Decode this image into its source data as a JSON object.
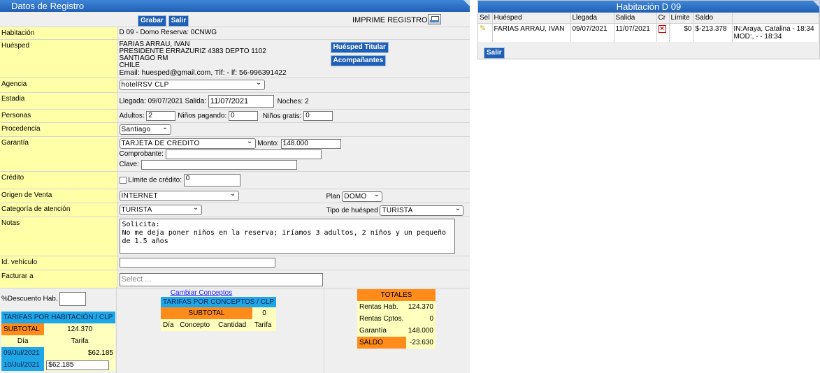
{
  "registro": {
    "title": "Datos de Registro",
    "grabar_label": "Grabar",
    "salir_label": "Salir",
    "imprime_label": "IMPRIME REGISTRO:",
    "fields": {
      "habitacion_label": "Habitación",
      "habitacion_value": "D 09 - Domo Reserva: 0CNWG",
      "huesped_label": "Huésped",
      "huesped_name": "FARIAS ARRAU, IVAN",
      "huesped_address": "PRESIDENTE ERRAZURIZ 4383 DEPTO 1102",
      "huesped_city": "SANTIAGO RM",
      "huesped_country": "CHILE",
      "huesped_contact": "Email: huesped@gmail.com, Tlf: -   lf: 56-996391422",
      "huesped_titular_label": "Huésped Titular",
      "acompanantes_label": "Acompañantes",
      "agencia_label": "Agencia",
      "agencia_value": "hotelRSV CLP",
      "estadia_label": "Estadia",
      "llegada_text": "Llegada: 09/07/2021 Salida:",
      "salida_value": "11/07/2021",
      "noches_text": "Noches: 2",
      "personas_label": "Personas",
      "adultos_label": "Adultos:",
      "adultos_value": "2",
      "ninos_pagando_label": "Niños pagando:",
      "ninos_pagando_value": "0",
      "ninos_gratis_label": "Niños gratis:",
      "ninos_gratis_value": "0",
      "procedencia_label": "Procedencia",
      "procedencia_value": "Santiago",
      "garantia_label": "Garantía",
      "garantia_value": "TARJETA DE CREDITO",
      "monto_label": "Monto:",
      "monto_value": "148.000",
      "comprobante_label": "Comprobante:",
      "clave_label": "Clave:",
      "credito_label": "Crédito",
      "limite_label": "Límite de crédito:",
      "limite_value": "0",
      "origen_label": "Origen de Venta",
      "origen_value": "INTERNET",
      "plan_label": "Plan",
      "plan_value": "DOMO",
      "categoria_label": "Categoría de atención",
      "categoria_value": "TURISTA",
      "tipo_huesped_label": "Tipo de huésped",
      "tipo_huesped_value": "TURISTA",
      "notas_label": "Notas",
      "notas_value": "Solicita:\nNo me deja poner niños en la reserva; iríamos 3 adultos, 2 niños y un pequeño de 1.5 años",
      "vehiculo_label": "Id. vehículo",
      "facturar_label": "Facturar a",
      "facturar_placeholder": "Select ..."
    },
    "descuento_label": "%Descuento Hab.",
    "tarifas_hab": {
      "title": "TARIFAS POR HABITACIÓN / CLP",
      "subtotal_label": "SUBTOTAL",
      "subtotal_value": "124.370",
      "col_dia": "Día",
      "col_tarifa": "Tarifa",
      "rows": [
        {
          "dia": "09/Jul/2021",
          "tarifa": "$62.185"
        },
        {
          "dia": "10/Jul/2021",
          "tarifa": "$62.185"
        }
      ]
    },
    "cambiar_conceptos_label": "Cambiar Conceptos",
    "tarifas_conceptos": {
      "title": "TARIFAS POR CONCEPTOS / CLP",
      "subtotal_label": "SUBTOTAL",
      "subtotal_value": "0",
      "col_dia": "Día",
      "col_concepto": "Concepto",
      "col_cantidad": "Cantidad",
      "col_tarifa": "Tarifa"
    },
    "totales": {
      "title": "TOTALES",
      "rentas_hab_label": "Rentas Hab.",
      "rentas_hab_value": "124.370",
      "rentas_cptos_label": "Rentas Cptos.",
      "rentas_cptos_value": "0",
      "garantia_label": "Garantía",
      "garantia_value": "148.000",
      "saldo_label": "SALDO",
      "saldo_value": "-23.630"
    }
  },
  "habitacion": {
    "title": "Habitación D 09",
    "columns": [
      "Sel",
      "Huésped",
      "Llegada",
      "Salida",
      "Cr",
      "Límite",
      "Saldo",
      ""
    ],
    "row": {
      "huesped": "FARIAS ARRAU, IVAN",
      "llegada": "09/07/2021",
      "salida": "11/07/2021",
      "limite": "$0",
      "saldo": "$-213.378",
      "info_line1": "IN:Araya, Catalina - 18:34",
      "info_line2": "MOD:, - - 18:34"
    },
    "salir_label": "Salir"
  },
  "colors": {
    "titlebar": "#1f5fb5",
    "label_bg": "#ffffa8",
    "cyan_header": "#1ea7e6",
    "orange_header": "#ff8c1a"
  }
}
